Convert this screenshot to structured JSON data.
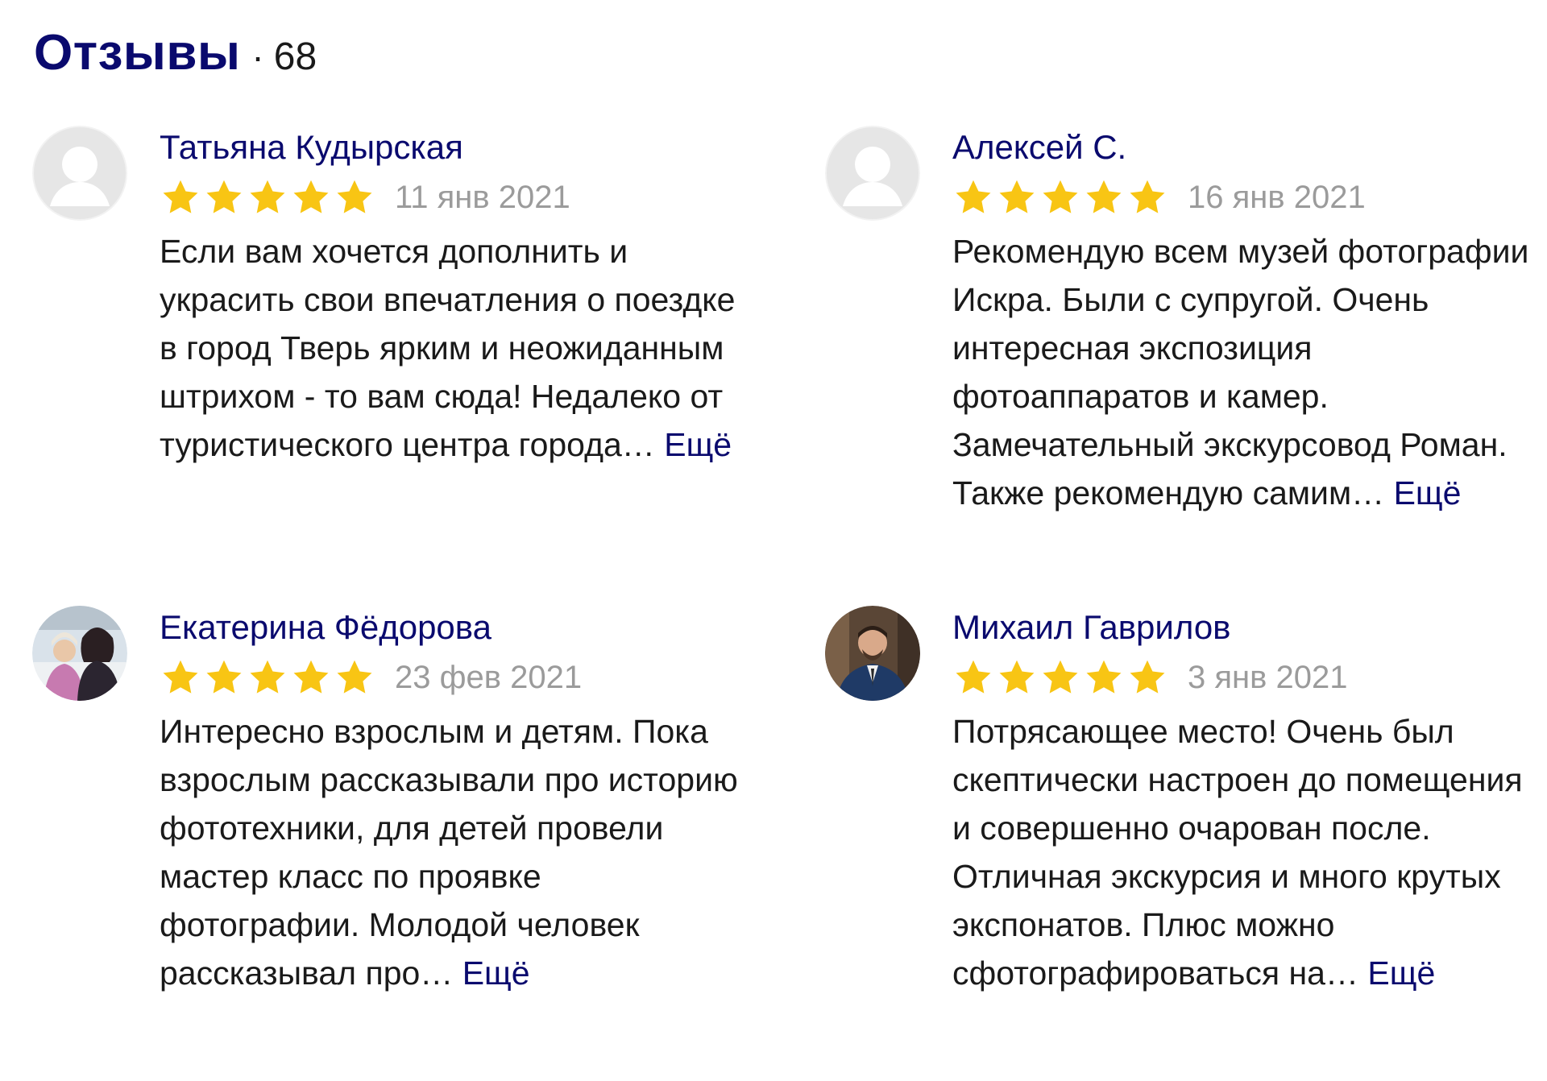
{
  "header": {
    "title": "Отзывы",
    "separator": "·",
    "count": "68"
  },
  "colors": {
    "title": "#0a0a6e",
    "link": "#0a0a6e",
    "star": "#f8c514",
    "date": "#9b9b9b"
  },
  "reviews": [
    {
      "author": "Татьяна Кудырская",
      "rating": 5,
      "date": "11 янв 2021",
      "text": "Если вам хочется дополнить и украсить свои впечатления о поездке в город Тверь ярким и неожиданным штрихом - то вам сюда! Недалеко от туристического центра города…",
      "more": "Ещё",
      "avatar": "placeholder-avatar-icon"
    },
    {
      "author": "Алексей С.",
      "rating": 5,
      "date": "16 янв 2021",
      "text": "Рекомендую всем музей фотографии Искра. Были с супругой. Очень интересная экспозиция фотоаппаратов и камер. Замечательный экскурсовод Роман. Также рекомендую самим…",
      "more": "Ещё",
      "avatar": "placeholder-avatar-icon"
    },
    {
      "author": "Екатерина Фёдорова",
      "rating": 5,
      "date": "23 фев 2021",
      "text": "Интересно взрослым и детям. Пока взрослым рассказывали про историю фототехники, для детей провели мастер класс по проявке фотографии. Молодой человек рассказывал про…",
      "more": "Ещё",
      "avatar": "photo-avatar"
    },
    {
      "author": "Михаил Гаврилов",
      "rating": 5,
      "date": "3 янв 2021",
      "text": "Потрясающее место! Очень был скептически настроен до помещения и совершенно очарован после. Отличная экскурсия и много крутых экспонатов. Плюс можно сфотографироваться на…",
      "more": "Ещё",
      "avatar": "photo-avatar"
    }
  ]
}
